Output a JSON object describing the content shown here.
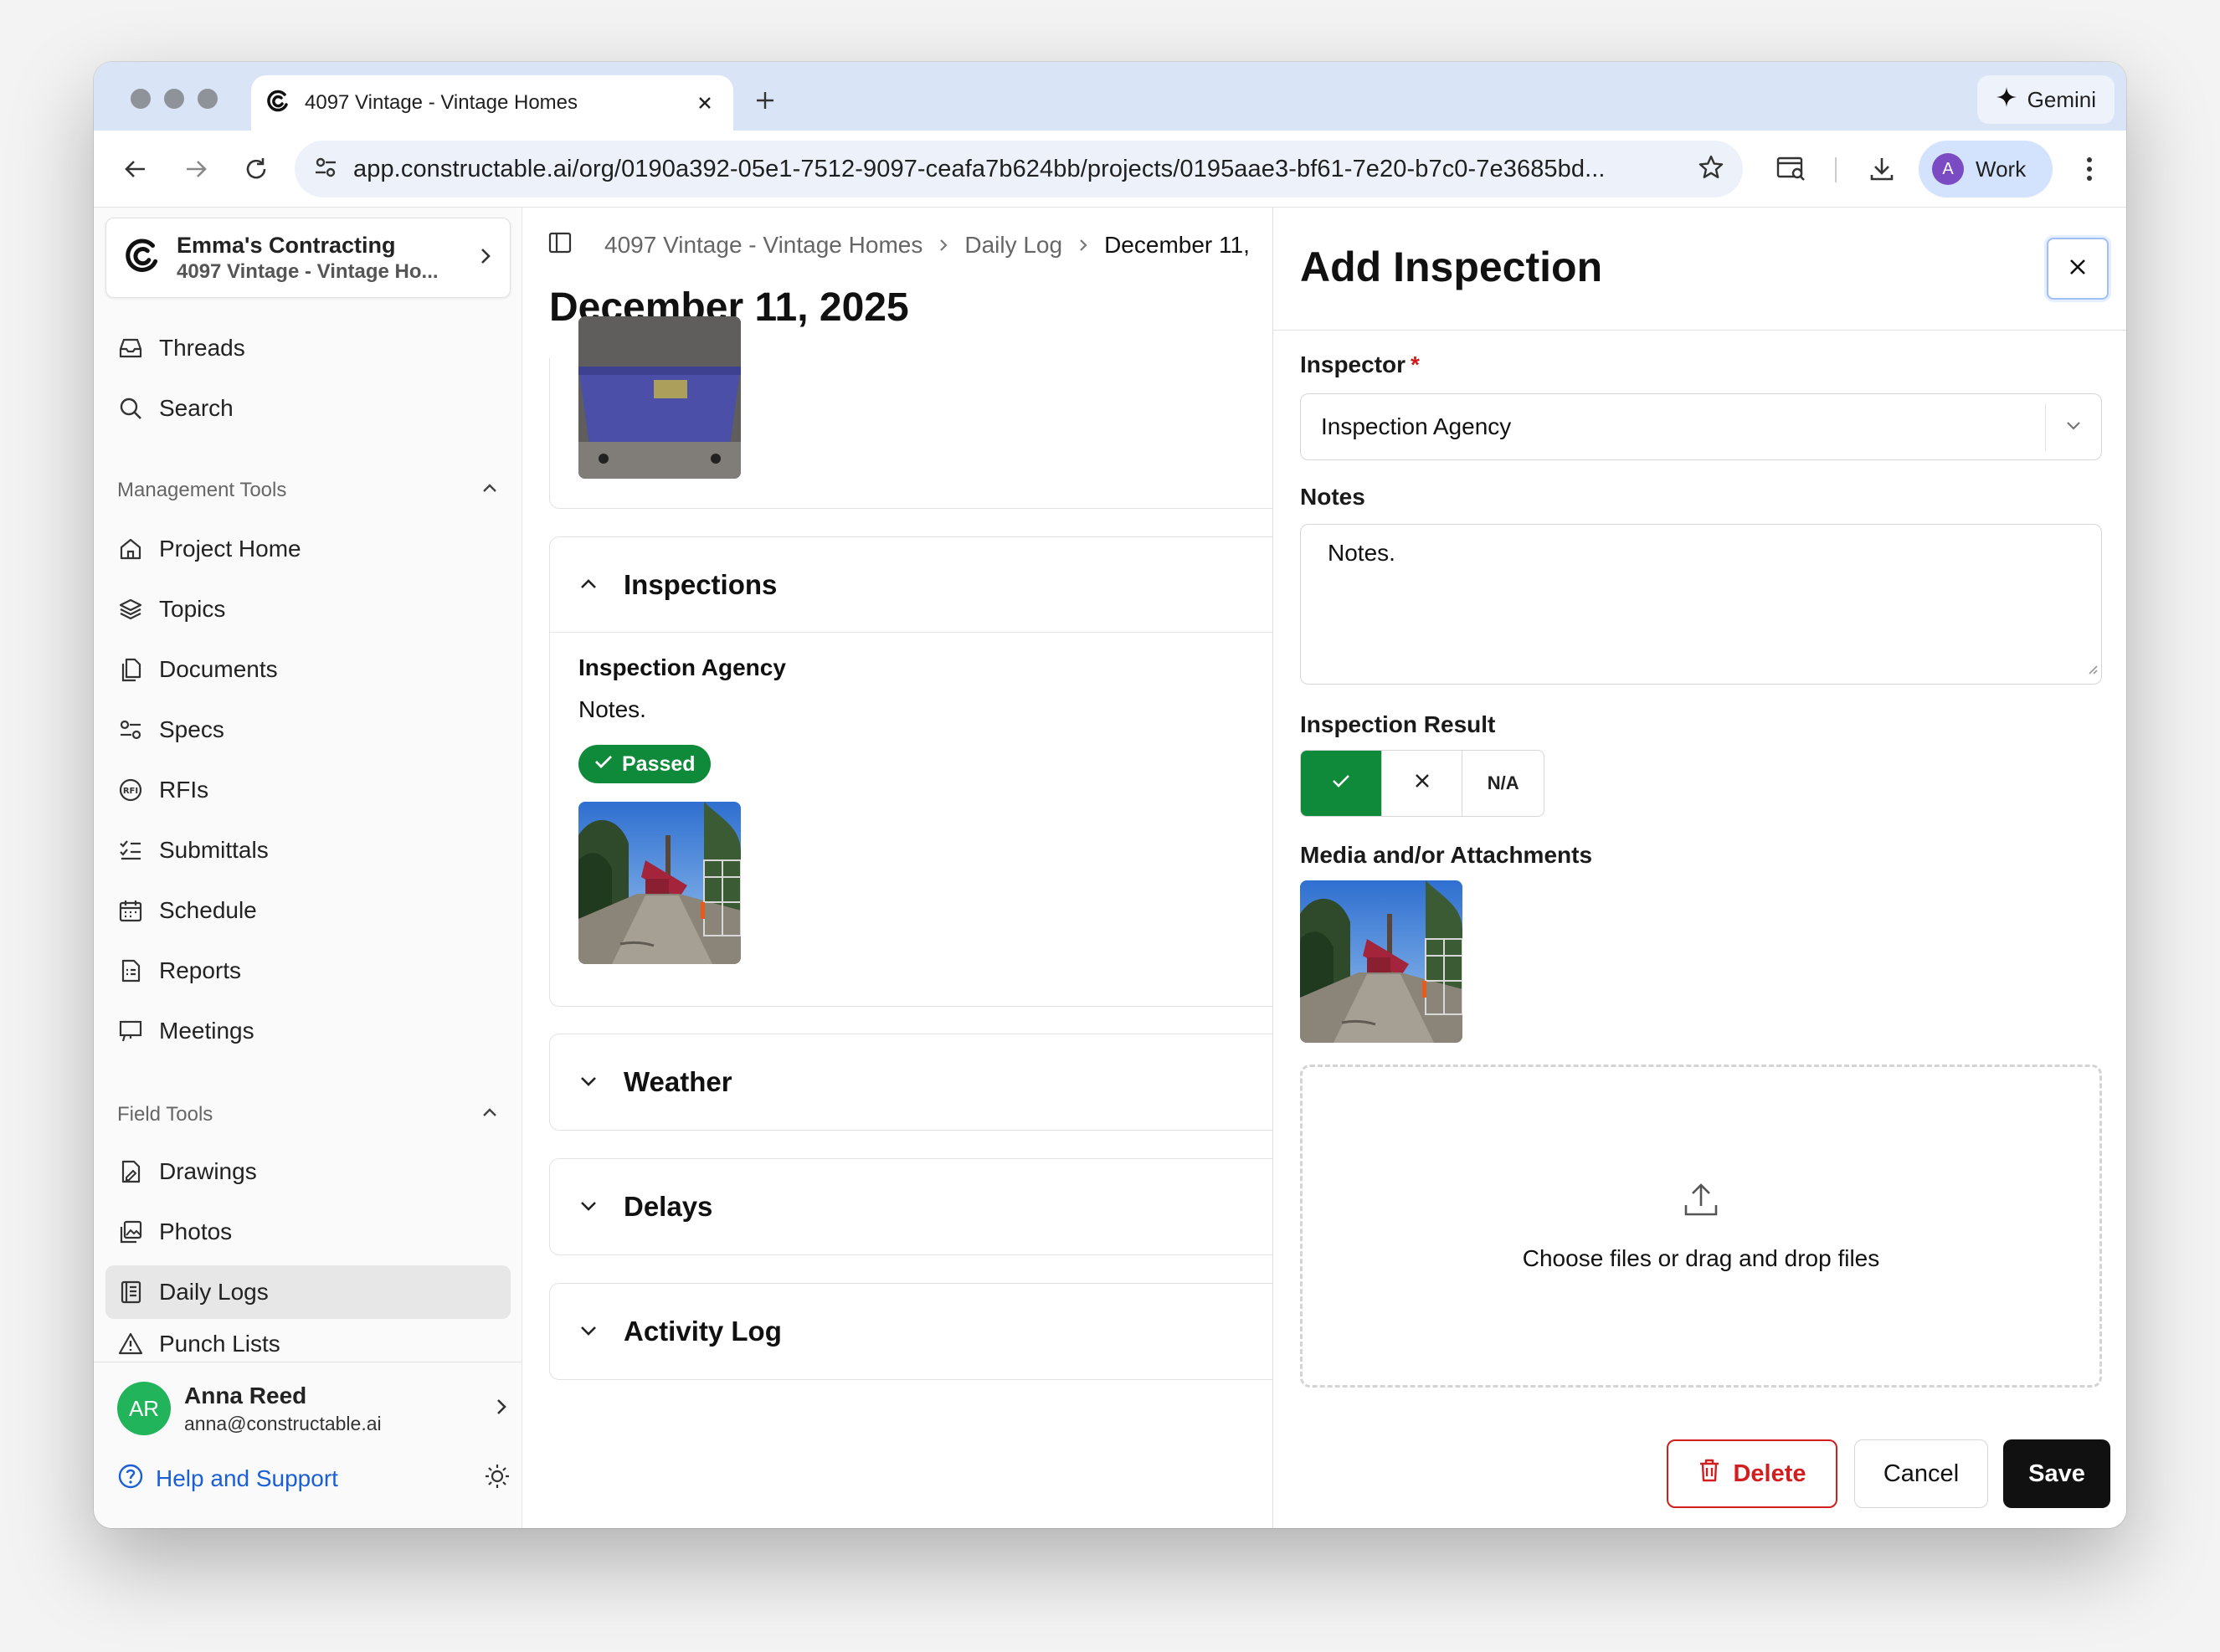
{
  "browser": {
    "tab_title": "4097 Vintage - Vintage Homes",
    "url": "app.constructable.ai/org/0190a392-05e1-7512-9097-ceafa7b624bb/projects/0195aae3-bf61-7e20-b7c0-7e3685bd...",
    "gemini_label": "Gemini",
    "profile_initial": "A",
    "profile_label": "Work"
  },
  "sidebar": {
    "org_name": "Emma's Contracting",
    "project_name": "4097 Vintage - Vintage Ho...",
    "top_items": [
      {
        "label": "Threads",
        "icon": "inbox-icon"
      },
      {
        "label": "Search",
        "icon": "search-icon"
      }
    ],
    "management_header": "Management Tools",
    "management_items": [
      {
        "label": "Project Home",
        "icon": "home-icon"
      },
      {
        "label": "Topics",
        "icon": "layers-icon"
      },
      {
        "label": "Documents",
        "icon": "documents-icon"
      },
      {
        "label": "Specs",
        "icon": "specs-icon"
      },
      {
        "label": "RFIs",
        "icon": "rfi-icon"
      },
      {
        "label": "Submittals",
        "icon": "checklist-icon"
      },
      {
        "label": "Schedule",
        "icon": "calendar-icon"
      },
      {
        "label": "Reports",
        "icon": "report-icon"
      },
      {
        "label": "Meetings",
        "icon": "presentation-icon"
      }
    ],
    "field_header": "Field Tools",
    "field_items": [
      {
        "label": "Drawings",
        "icon": "drawing-icon"
      },
      {
        "label": "Photos",
        "icon": "photos-icon"
      },
      {
        "label": "Daily Logs",
        "icon": "daily-log-icon",
        "active": true
      },
      {
        "label": "Punch Lists",
        "icon": "warning-icon"
      }
    ],
    "user": {
      "initials": "AR",
      "name": "Anna Reed",
      "email": "anna@constructable.ai"
    },
    "help_label": "Help and Support"
  },
  "main": {
    "breadcrumb": [
      "4097 Vintage - Vintage Homes",
      "Daily Log",
      "December 11,"
    ],
    "title": "December 11, 2025",
    "inspections": {
      "heading": "Inspections",
      "entry_name": "Inspection Agency",
      "entry_notes": "Notes.",
      "status": "Passed"
    },
    "sections": [
      "Weather",
      "Delays",
      "Activity Log"
    ]
  },
  "drawer": {
    "title": "Add Inspection",
    "inspector_label": "Inspector",
    "required_mark": "*",
    "inspector_value": "Inspection Agency",
    "notes_label": "Notes",
    "notes_value": "Notes.",
    "result_label": "Inspection Result",
    "result_options": [
      "pass",
      "fail",
      "N/A"
    ],
    "result_selected": "pass",
    "media_label": "Media and/or Attachments",
    "dropzone_text": "Choose files or drag and drop files",
    "delete_label": "Delete",
    "cancel_label": "Cancel",
    "save_label": "Save"
  },
  "colors": {
    "accent_green": "#0f8a3a",
    "danger_red": "#d21e1e",
    "link_blue": "#1a5fd6"
  }
}
